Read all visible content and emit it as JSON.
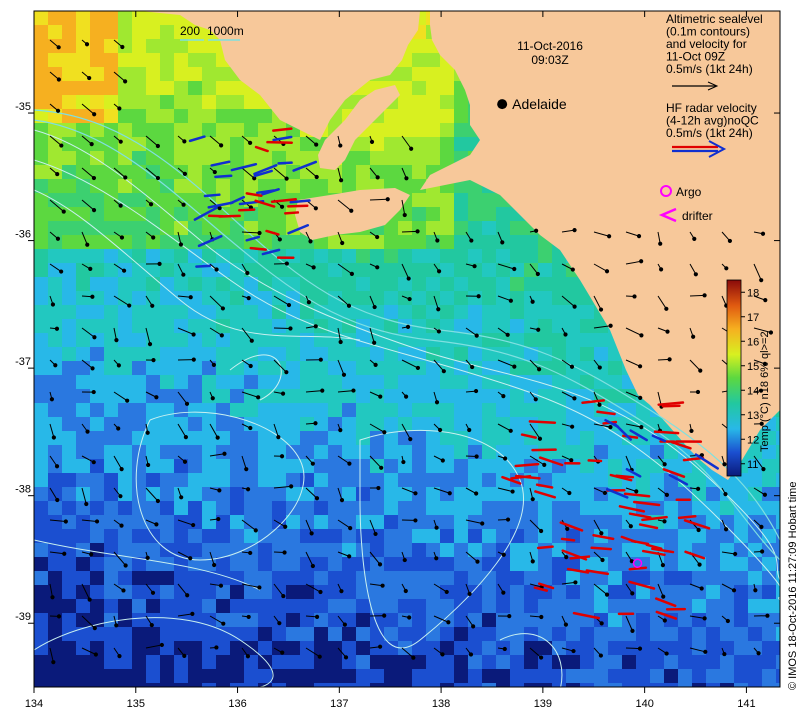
{
  "header": {
    "date": "11-Oct-2016",
    "time": "09:03Z"
  },
  "scale_bar": {
    "label_a": "200",
    "label_b": "1000m"
  },
  "places": [
    {
      "name": "Adelaide",
      "lon": 138.6,
      "lat": -34.93
    }
  ],
  "legend": {
    "altimetry": {
      "lines": [
        "Altimetric sealevel",
        "(0.1m contours)",
        "and velocity for",
        "11-Oct 09Z",
        "0.5m/s (1kt 24h)"
      ],
      "arrow_color": "#000000"
    },
    "hf_radar": {
      "lines": [
        "HF radar velocity",
        "(4-12h avg)noQC",
        "0.5m/s (1kt 24h)"
      ],
      "arrow_colors": [
        "#e00000",
        "#1030d0"
      ]
    },
    "argo": {
      "label": "Argo",
      "color": "#ff00ff"
    },
    "drifter": {
      "label": "drifter",
      "color": "#ff00ff"
    }
  },
  "colorbar": {
    "title": "Temp (°C) n18 6% ql>=2",
    "ticks": [
      "18",
      "17",
      "16",
      "15",
      "14",
      "13",
      "12",
      "11"
    ],
    "range": [
      10.5,
      18.5
    ]
  },
  "footer_credit": "© IMOS 18-Oct-2016 11:27:09 Hobart time",
  "axes": {
    "lon_ticks": [
      "134",
      "135",
      "136",
      "137",
      "138",
      "139",
      "140",
      "141"
    ],
    "lat_ticks": [
      "-35",
      "-36",
      "-37",
      "-38",
      "-39"
    ],
    "lon_range": [
      134.0,
      141.33
    ],
    "lat_range": [
      -39.5,
      -34.2
    ]
  },
  "argo_floats": [
    {
      "lon": 139.93,
      "lat": -38.53
    }
  ],
  "colors": {
    "land": "#f7c89a",
    "coast": "#8a1a1a",
    "contour": "#c8f0f0",
    "shelf": "#7fe0e0"
  }
}
